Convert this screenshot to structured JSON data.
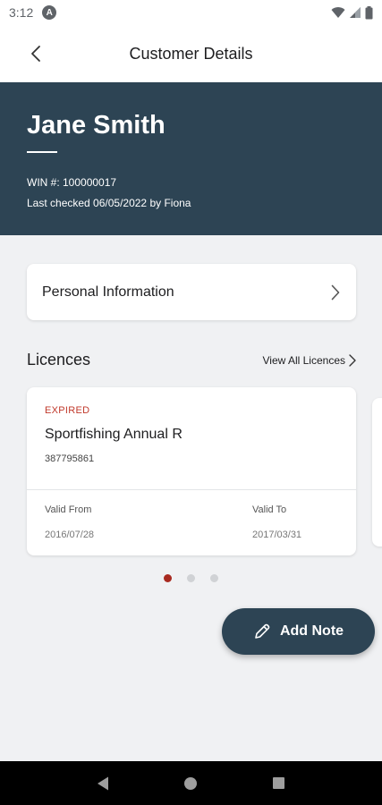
{
  "status_bar": {
    "time": "3:12",
    "app_icon": "A"
  },
  "app_bar": {
    "title": "Customer Details"
  },
  "customer": {
    "name": "Jane Smith",
    "win_line": "WIN #: 100000017",
    "last_checked": "Last checked 06/05/2022 by Fiona"
  },
  "personal_info": {
    "label": "Personal Information"
  },
  "licences": {
    "title": "Licences",
    "view_all": "View All Licences",
    "items": [
      {
        "status": "EXPIRED",
        "name": "Sportfishing Annual R",
        "number": "387795861",
        "valid_from_label": "Valid From",
        "valid_from": "2016/07/28",
        "valid_to_label": "Valid To",
        "valid_to": "2017/03/31"
      }
    ],
    "page_count": 3,
    "active_page": 1
  },
  "fab": {
    "label": "Add Note"
  },
  "colors": {
    "header": "#2d4454",
    "expired": "#c0392b",
    "active_dot": "#a82a20",
    "background": "#f0f1f3"
  }
}
